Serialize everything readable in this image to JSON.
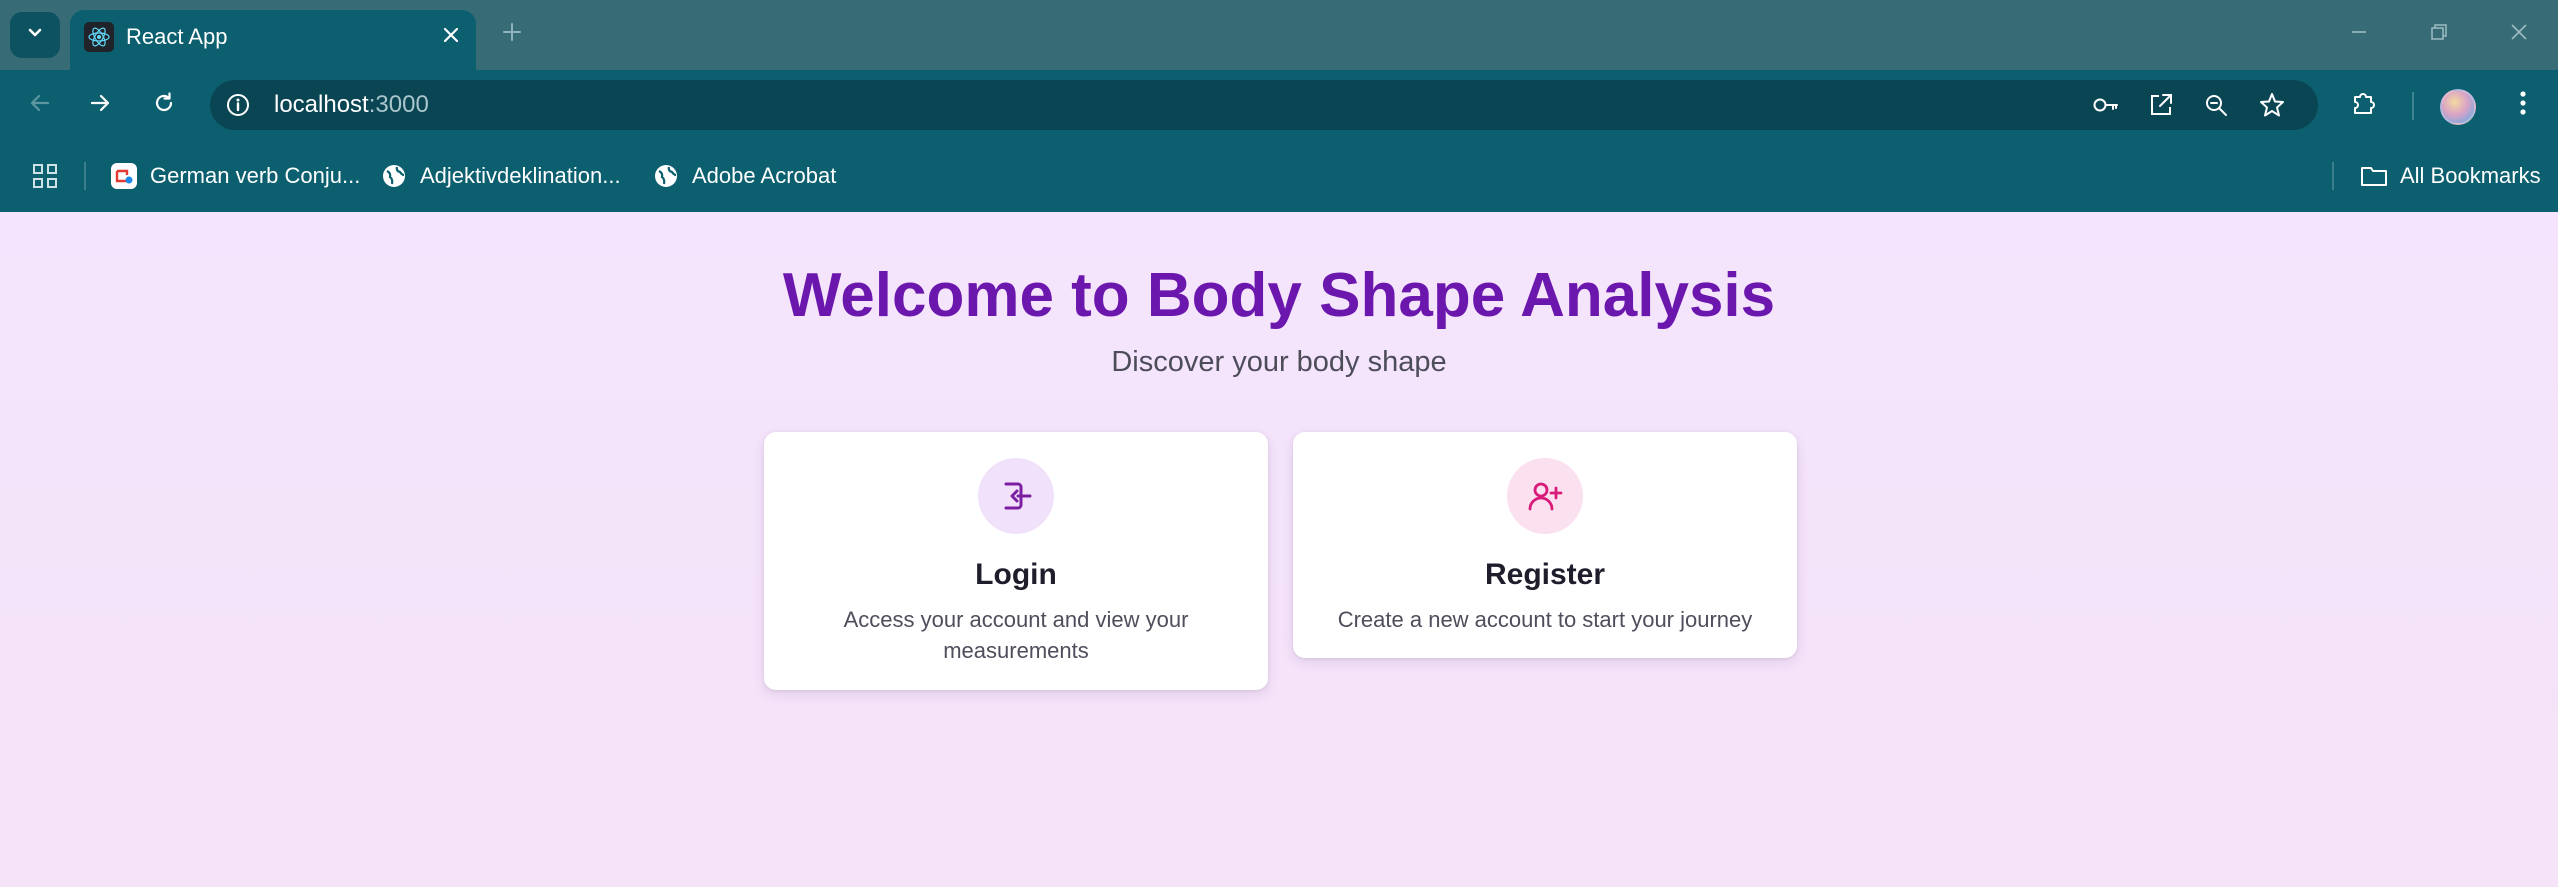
{
  "browser": {
    "tab": {
      "title": "React App",
      "icon": "react-logo-icon"
    },
    "address": {
      "host": "localhost",
      "port": ":3000"
    },
    "bookmarks": [
      {
        "label": "German verb Conju...",
        "icon": "conjugation-favicon-icon"
      },
      {
        "label": "Adjektivdeklination...",
        "icon": "globe-icon"
      },
      {
        "label": "Adobe Acrobat",
        "icon": "globe-icon"
      }
    ],
    "all_bookmarks_label": "All Bookmarks",
    "colors": {
      "frame": "#376b76",
      "toolbar": "#0b5f6e",
      "omnibox": "#0a4554"
    }
  },
  "page": {
    "title": "Welcome to Body Shape Analysis",
    "subtitle": "Discover your body shape",
    "cards": [
      {
        "title": "Login",
        "description": "Access your account and view your measurements",
        "icon": "login-icon",
        "accent": "#7b1fa2"
      },
      {
        "title": "Register",
        "description": "Create a new account to start your journey",
        "icon": "user-plus-icon",
        "accent": "#d81b7a"
      }
    ],
    "colors": {
      "background": "#f4e4fb",
      "title": "#6b16ad"
    }
  }
}
